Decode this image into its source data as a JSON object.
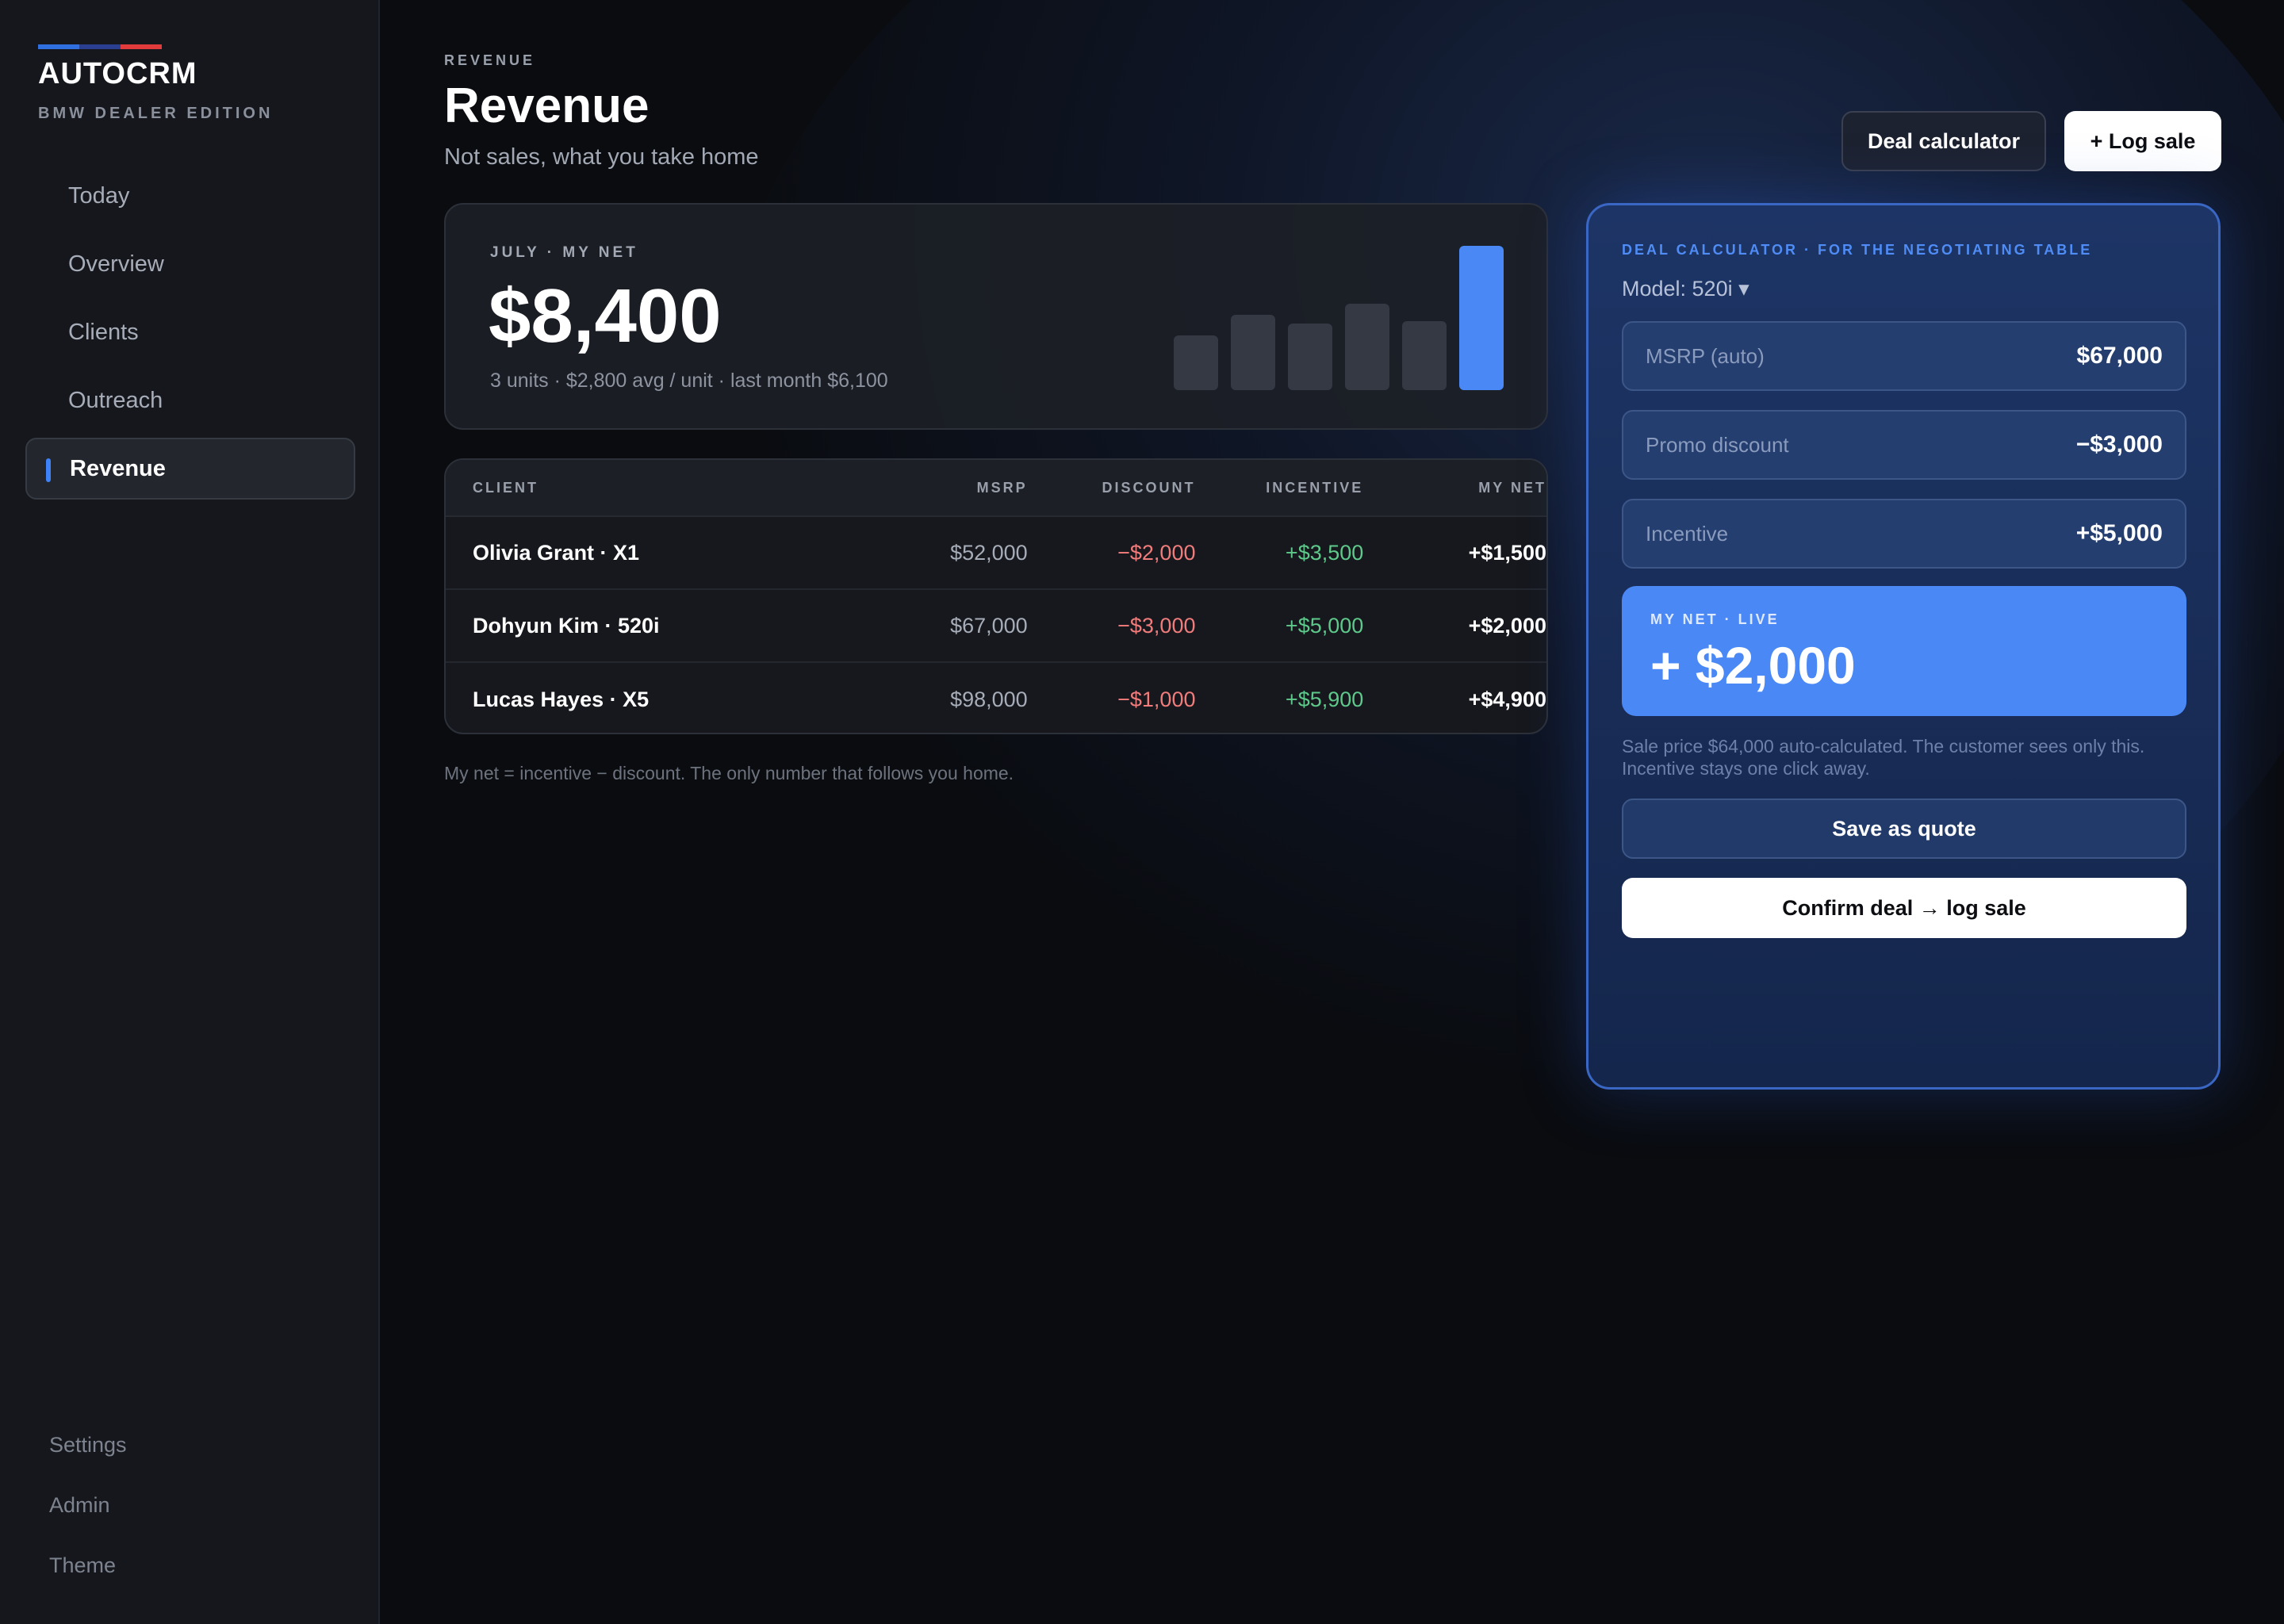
{
  "brand": {
    "name": "AUTOCRM",
    "edition": "BMW DEALER EDITION",
    "stripe_colors": [
      "#2f6fe0",
      "#2a3f8f",
      "#e23b3b"
    ]
  },
  "sidebar": {
    "items": [
      {
        "label": "Today",
        "active": false
      },
      {
        "label": "Overview",
        "active": false
      },
      {
        "label": "Clients",
        "active": false
      },
      {
        "label": "Outreach",
        "active": false
      },
      {
        "label": "Revenue",
        "active": true
      }
    ],
    "bottom_items": [
      {
        "label": "Settings"
      },
      {
        "label": "Admin"
      },
      {
        "label": "Theme"
      }
    ]
  },
  "header": {
    "eyebrow": "REVENUE",
    "title": "Revenue",
    "subtitle": "Not sales, what you take home",
    "calculator_button": "Deal calculator",
    "log_sale_button": "+ Log sale"
  },
  "summary": {
    "label": "JULY · MY NET",
    "amount": "$8,400",
    "meta": "3 units · $2,800 avg / unit · last month $6,100",
    "bar_levels": [
      0.38,
      0.52,
      0.46,
      0.6,
      0.48,
      1.0
    ],
    "bar_colors": {
      "default": "#353944",
      "current": "#4a88f5"
    }
  },
  "table": {
    "headers": {
      "client": "CLIENT",
      "msrp": "MSRP",
      "discount": "DISCOUNT",
      "incentive": "INCENTIVE",
      "net": "MY NET"
    },
    "rows": [
      {
        "client": "Olivia Grant · X1",
        "msrp": "$52,000",
        "discount": "−$2,000",
        "incentive": "+$3,500",
        "net": "+$1,500"
      },
      {
        "client": "Dohyun Kim · 520i",
        "msrp": "$67,000",
        "discount": "−$3,000",
        "incentive": "+$5,000",
        "net": "+$2,000"
      },
      {
        "client": "Lucas Hayes · X5",
        "msrp": "$98,000",
        "discount": "−$1,000",
        "incentive": "+$5,900",
        "net": "+$4,900"
      }
    ],
    "footnote": "My net = incentive − discount. The only number that follows you home."
  },
  "calculator": {
    "eyebrow": "DEAL CALCULATOR · FOR THE NEGOTIATING TABLE",
    "model": "Model: 520i ▾",
    "fields": [
      {
        "label": "MSRP (auto)",
        "value": "$67,000"
      },
      {
        "label": "Promo discount",
        "value": "−$3,000"
      },
      {
        "label": "Incentive",
        "value": "+$5,000"
      }
    ],
    "net_label": "MY NET · LIVE",
    "net_value": "+ $2,000",
    "note": "Sale price $64,000 auto-calculated. The customer sees only this. Incentive stays one click away.",
    "save_button": "Save as quote",
    "confirm_button": "Confirm deal → log sale"
  }
}
